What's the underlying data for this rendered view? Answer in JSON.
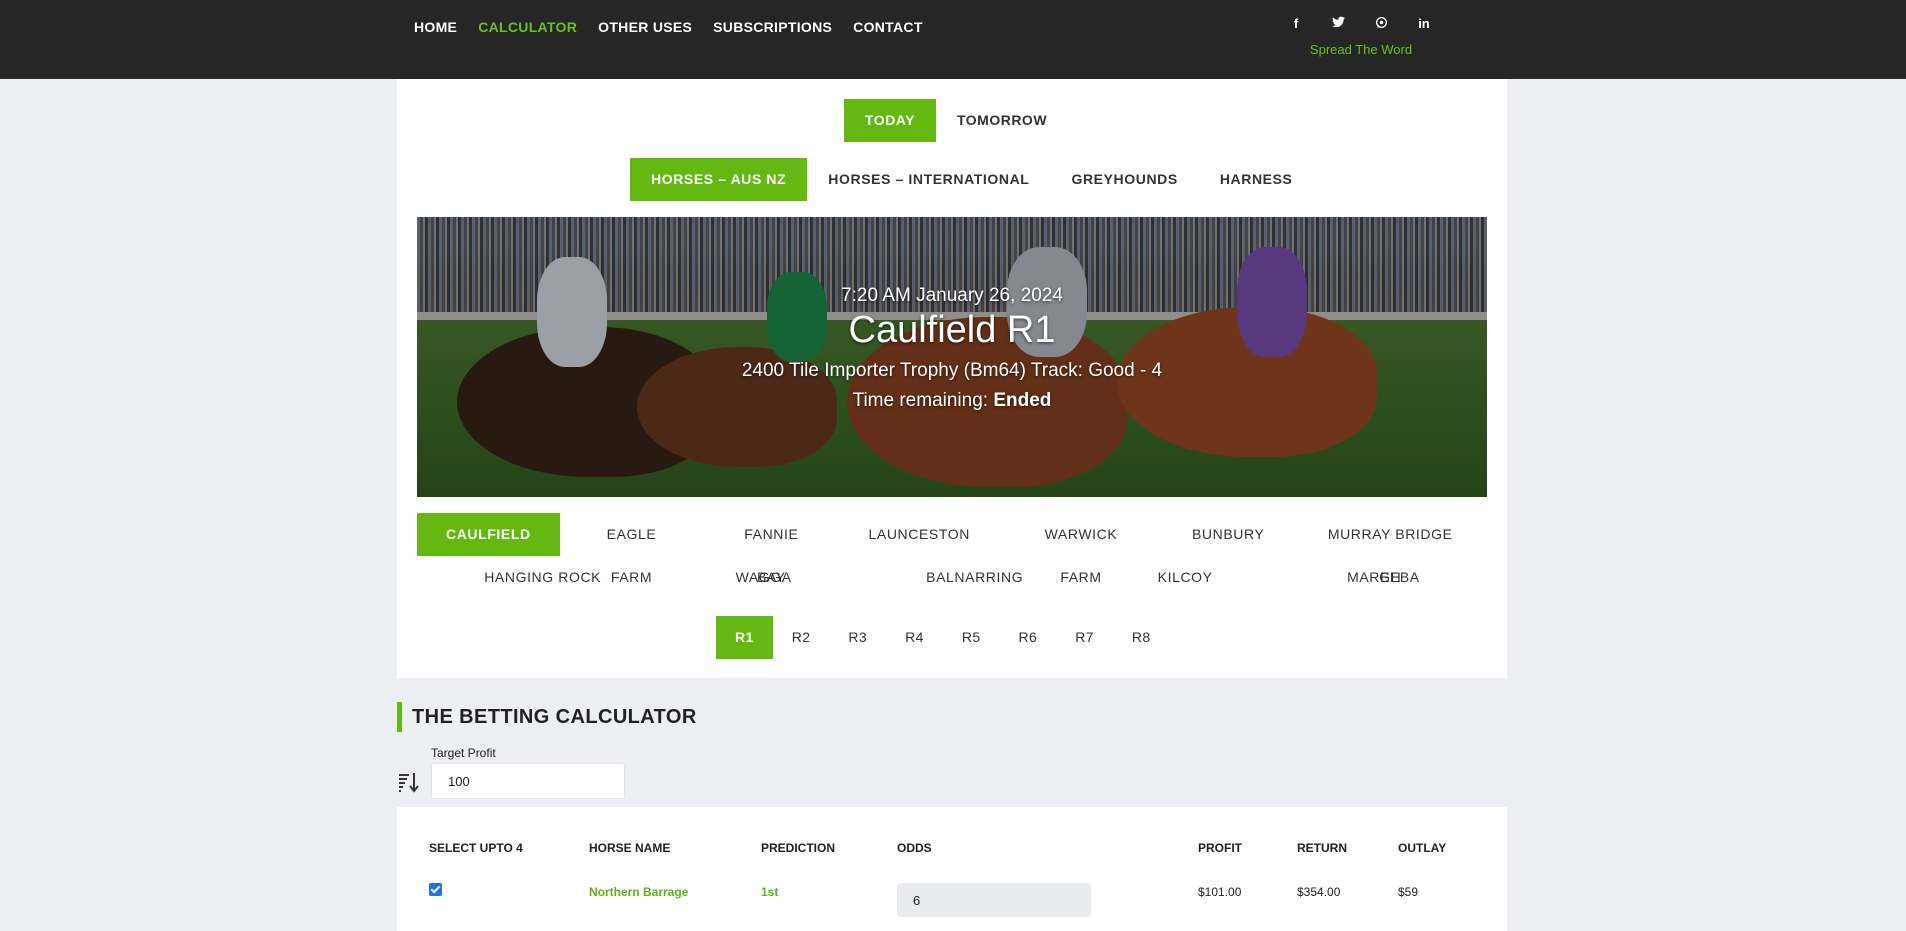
{
  "nav": {
    "items": [
      "HOME",
      "CALCULATOR",
      "OTHER USES",
      "SUBSCRIPTIONS",
      "CONTACT"
    ],
    "active": "CALCULATOR"
  },
  "social": {
    "icons": [
      "facebook-icon",
      "twitter-icon",
      "whatsapp-icon",
      "linkedin-icon"
    ],
    "glyphs": [
      "f",
      "t",
      "w",
      "in"
    ],
    "spread_text": "Spread The Word"
  },
  "day_tabs": [
    "TODAY",
    "TOMORROW"
  ],
  "type_tabs": [
    "HORSES – AUS NZ",
    "HORSES – INTERNATIONAL",
    "GREYHOUNDS",
    "HARNESS"
  ],
  "hero": {
    "datetime": "7:20 AM January 26, 2024",
    "title": "Caulfield R1",
    "description": "2400  Tile Importer Trophy (Bm64) Track: Good - 4",
    "remaining_label": "Time remaining:",
    "remaining_value": "Ended"
  },
  "venues": {
    "row1": [
      "CAULFIELD",
      "EAGLE FARM",
      "FANNIE BAY",
      "LAUNCESTON",
      "WARWICK FARM",
      "BUNBURY",
      "MURRAY BRIDGE GH"
    ],
    "row2": [
      "HANGING ROCK",
      "WAGGA",
      "BALNARRING",
      "KILCOY",
      "MAREEBA"
    ]
  },
  "races": [
    "R1",
    "R2",
    "R3",
    "R4",
    "R5",
    "R6",
    "R7",
    "R8"
  ],
  "calculator": {
    "heading": "THE BETTING CALCULATOR",
    "target_label": "Target Profit",
    "target_value": "100"
  },
  "table": {
    "headers": [
      "SELECT UPTO 4",
      "HORSE NAME",
      "PREDICTION",
      "ODDS",
      "PROFIT",
      "RETURN",
      "OUTLAY"
    ],
    "rows": [
      {
        "selected": true,
        "horse": "Northern Barrage",
        "prediction": "1st",
        "odds": "6",
        "profit": "$101.00",
        "return": "$354.00",
        "outlay": "$59"
      }
    ]
  },
  "colors": {
    "accent": "#64b811",
    "nav_bg": "#262626",
    "page_bg": "#eceef2"
  }
}
